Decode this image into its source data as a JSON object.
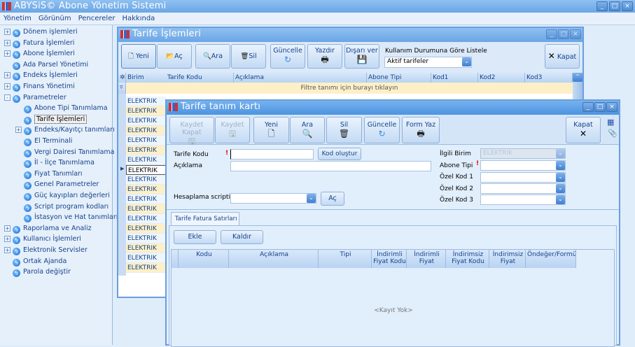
{
  "app": {
    "title": "ABYSiS© Abone Yönetim Sistemi"
  },
  "menu": [
    "Yönetim",
    "Görünüm",
    "Pencereler",
    "Hakkında"
  ],
  "tree": [
    {
      "label": "Dönem işlemleri",
      "level": 0,
      "exp": "+"
    },
    {
      "label": "Fatura İşlemleri",
      "level": 0,
      "exp": "+"
    },
    {
      "label": "Abone İşlemleri",
      "level": 0,
      "exp": "+"
    },
    {
      "label": "Ada Parsel Yönetimi",
      "level": 0,
      "exp": ""
    },
    {
      "label": "Endeks İşlemleri",
      "level": 0,
      "exp": "+"
    },
    {
      "label": "Finans Yönetimi",
      "level": 0,
      "exp": "+"
    },
    {
      "label": "Parametreler",
      "level": 0,
      "exp": "-"
    },
    {
      "label": "Abone Tipi Tanımlama",
      "level": 1,
      "exp": ""
    },
    {
      "label": "Tarife İşlemleri",
      "level": 1,
      "exp": "",
      "selected": true
    },
    {
      "label": "Endeks/Kayıtçı tanımları",
      "level": 1,
      "exp": "+"
    },
    {
      "label": "El Terminali",
      "level": 1,
      "exp": ""
    },
    {
      "label": "Vergi Dairesi Tanımlama",
      "level": 1,
      "exp": ""
    },
    {
      "label": "İl - İlçe Tanımlama",
      "level": 1,
      "exp": ""
    },
    {
      "label": "Fiyat Tanımları",
      "level": 1,
      "exp": ""
    },
    {
      "label": "Genel Parametreler",
      "level": 1,
      "exp": ""
    },
    {
      "label": "Güç kayıpları değerleri",
      "level": 1,
      "exp": ""
    },
    {
      "label": "Script program kodları",
      "level": 1,
      "exp": ""
    },
    {
      "label": "İstasyon ve Hat tanımları",
      "level": 1,
      "exp": ""
    },
    {
      "label": "Raporlama ve Analiz",
      "level": 0,
      "exp": "+"
    },
    {
      "label": "Kullanıcı İşlemleri",
      "level": 0,
      "exp": "+"
    },
    {
      "label": "Elektronik Servisler",
      "level": 0,
      "exp": "+"
    },
    {
      "label": "Ortak Ajanda",
      "level": 0,
      "exp": ""
    },
    {
      "label": "Parola değiştir",
      "level": 0,
      "exp": ""
    }
  ],
  "tarife_islemleri": {
    "title": "Tarife İşlemleri",
    "toolbar": {
      "yeni": "Yeni",
      "ac": "Aç",
      "ara": "Ara",
      "sil": "Sil",
      "guncelle": "Güncelle",
      "yazdir": "Yazdır",
      "disari_ver": "Dışarı ver",
      "kapat": "Kapat"
    },
    "filter_label": "Kullanım Durumuna Göre Listele",
    "filter_value": "Aktif tarifeler",
    "columns": [
      "Birim",
      "Tarife Kodu",
      "Açıklama",
      "Abone Tipi",
      "Kod1",
      "Kod2",
      "Kod3"
    ],
    "filter_row": "Filtre tanımı için burayı tıklayın",
    "rows": [
      "ELEKTRIK",
      "ELEKTRIK",
      "ELEKTRIK",
      "ELEKTRIK",
      "ELEKTRIK",
      "ELEKTRIK",
      "ELEKTRIK",
      "ELEKTRIK",
      "ELEKTRIK",
      "ELEKTRIK",
      "ELEKTRIK",
      "ELEKTRIK",
      "ELEKTRIK",
      "ELEKTRIK",
      "ELEKTRIK",
      "ELEKTRIK",
      "ELEKTRIK",
      "ELEKTRIK"
    ],
    "current_row": 7
  },
  "tanim_karti": {
    "title": "Tarife tanım kartı",
    "toolbar": {
      "kaydet_kapat": "Kaydet Kapat",
      "kaydet": "Kaydet",
      "yeni": "Yeni",
      "ara": "Ara",
      "sil": "Sil",
      "guncelle": "Güncelle",
      "form_yaz": "Form Yaz",
      "kapat": "Kapat"
    },
    "form": {
      "tarife_kodu": "Tarife Kodu",
      "tarife_kodu_value": "",
      "kod_olustur": "Kod oluştur",
      "aciklama": "Açıklama",
      "aciklama_value": "",
      "hesaplama": "Hesaplama scripti",
      "hesaplama_value": "",
      "ac": "Aç",
      "ilgili_birim": "İlgili Birim",
      "ilgili_birim_value": "ELEKTRIK",
      "abone_tipi": "Abone Tipi",
      "ozel_kod1": "Özel Kod 1",
      "ozel_kod2": "Özel Kod 2",
      "ozel_kod3": "Özel Kod 3"
    },
    "tab": "Tarife Fatura Satırları",
    "ekle": "Ekle",
    "kaldir": "Kaldır",
    "columns": [
      "Kodu",
      "Açıklama",
      "Tipi",
      "İndirimli Fiyat Kodu",
      "İndirimli Fiyat",
      "İndirimsiz Fiyat Kodu",
      "İndirimsiz Fiyat",
      "Öndeğer/Formül/Veri"
    ],
    "empty": "<Kayıt Yok>"
  }
}
